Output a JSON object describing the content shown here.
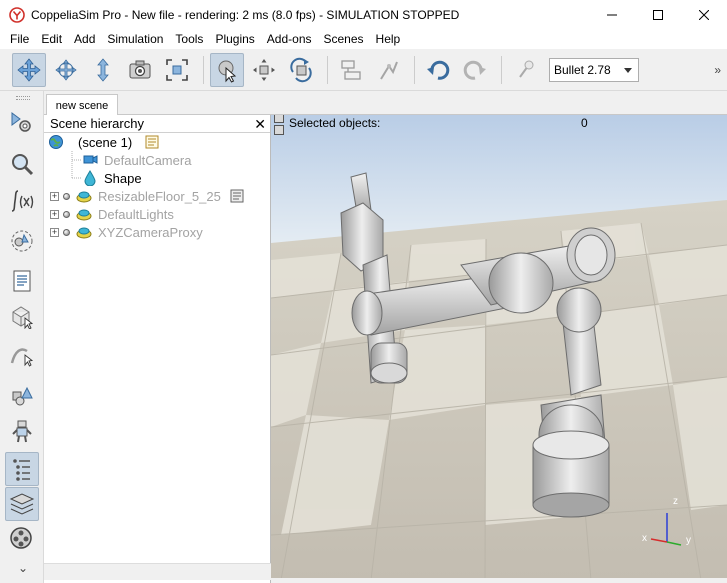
{
  "window": {
    "title": "CoppeliaSim Pro - New file - rendering: 2 ms (8.0 fps) - SIMULATION STOPPED",
    "minimize_glyph": "—",
    "maximize_glyph": "☐",
    "close_glyph": "✕"
  },
  "menu": [
    "File",
    "Edit",
    "Add",
    "Simulation",
    "Tools",
    "Plugins",
    "Add-ons",
    "Scenes",
    "Help"
  ],
  "toolbar": {
    "buttons": [
      "camera-pan-icon",
      "camera-rotate-icon",
      "camera-shift-icon",
      "camera-angle-icon",
      "fit-to-view-icon",
      "click-select-icon",
      "object-shift-icon",
      "object-rotate-icon",
      "assemble-icon",
      "transfer-dna-icon",
      "undo-icon",
      "redo-icon",
      "simulation-settings-icon"
    ],
    "engine_value": "Bullet 2.78",
    "more_glyph": "»"
  },
  "left_toolbar": {
    "buttons": [
      "simulation-settings-icon",
      "selection-icon",
      "calculation-modules-icon",
      "collections-icon",
      "scripts-icon",
      "shapes-edit-icon",
      "path-edit-icon",
      "user-settings-icon",
      "model-browser-icon",
      "scene-hierarchy-icon",
      "layers-icon",
      "video-recorder-icon"
    ],
    "more_glyph": "⌄"
  },
  "tabs": [
    "new scene"
  ],
  "hierarchy": {
    "title": "Scene hierarchy",
    "close_glyph": "✕",
    "items": [
      {
        "label": "(scene 1)",
        "icon": "globe-icon",
        "dim": false
      },
      {
        "label": "DefaultCamera",
        "icon": "camera-icon",
        "dim": true
      },
      {
        "label": "Shape",
        "icon": "shape-icon",
        "dim": false
      },
      {
        "label": "ResizableFloor_5_25",
        "icon": "model-icon",
        "dim": true
      },
      {
        "label": "DefaultLights",
        "icon": "model-icon",
        "dim": true
      },
      {
        "label": "XYZCameraProxy",
        "icon": "model-icon",
        "dim": true
      }
    ]
  },
  "viewport": {
    "selected_label": "Selected objects:",
    "selected_count": "0",
    "axis_labels": {
      "x": "x",
      "y": "y",
      "z": "z"
    }
  }
}
